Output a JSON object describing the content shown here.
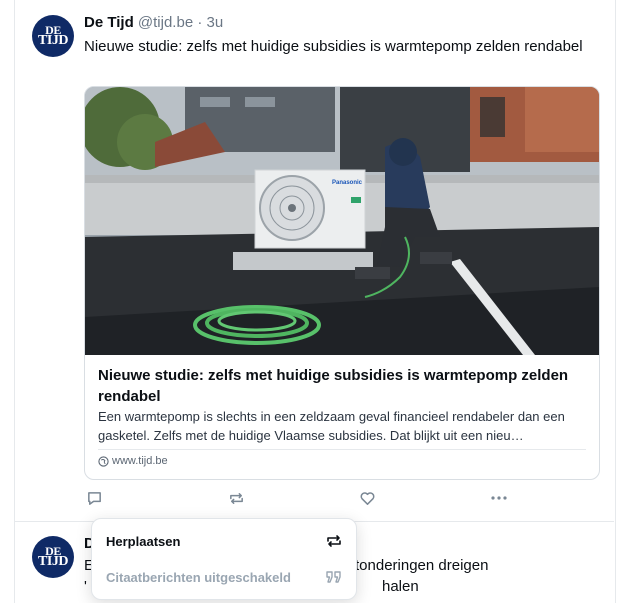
{
  "post1": {
    "avatar": {
      "line1": "DE",
      "line2": "TIJD"
    },
    "author_name": "De Tijd",
    "handle_time": "@tijd.be · 3u",
    "text": "Nieuwe studie: zelfs met huidige subsidies is warmtepomp zelden rendabel",
    "card": {
      "image_alt": "Man installeert een Panasonic warmtepomp op een plat dak",
      "brand_text": "Panasonic",
      "title": "Nieuwe studie: zelfs met huidige subsidies is warmtepomp zelden rendabel",
      "description": "Een warmtepomp is slechts in een zeldzaam geval financieel rendabeler dan een gasketel. Zelfs met de huidige Vlaamse subsidies. Dat blijkt uit een nieu…",
      "domain": "www.tijd.be"
    },
    "actions": {
      "reply_icon": "reply-icon",
      "repost_icon": "repost-icon",
      "like_icon": "heart-icon",
      "more_icon": "more-icon"
    }
  },
  "post2": {
    "avatar": {
      "line1": "DE",
      "line2": "TIJD"
    },
    "author_initial": "D",
    "text_line1_start": "E",
    "text_line1_end": "tonderingen dreigen",
    "text_line2_start": "'",
    "text_line2_end": "halen"
  },
  "repost_menu": {
    "repost_label": "Herplaatsen",
    "quote_label": "Citaatberichten uitgeschakeld",
    "repost_icon": "repost-icon",
    "quote_icon": "quote-icon",
    "quote_color": "#9aa6b2"
  }
}
